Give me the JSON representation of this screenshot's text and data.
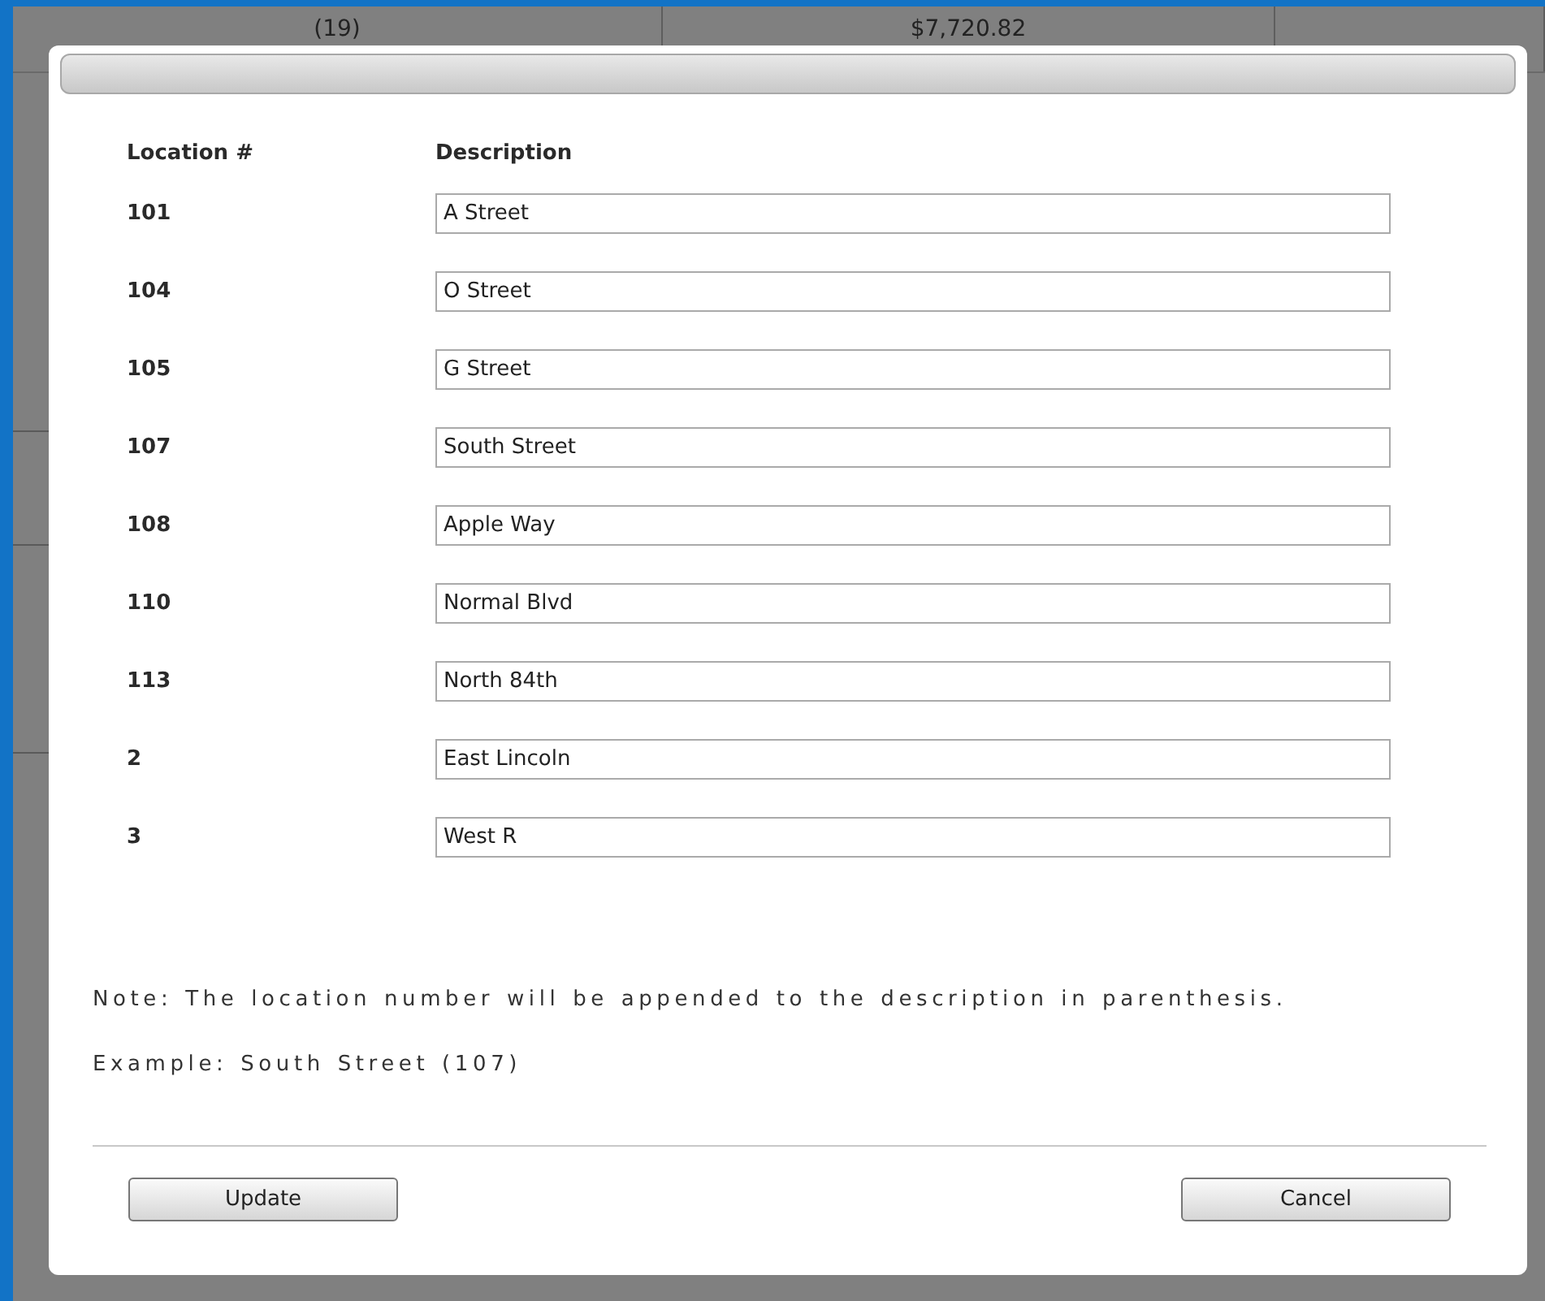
{
  "background_row": {
    "cells": [
      "(19)",
      "$7,720.82"
    ]
  },
  "dialog": {
    "columns": [
      "Location #",
      "Description"
    ],
    "rows": [
      {
        "location": "101",
        "description": "A Street"
      },
      {
        "location": "104",
        "description": "O Street"
      },
      {
        "location": "105",
        "description": "G Street"
      },
      {
        "location": "107",
        "description": "South Street"
      },
      {
        "location": "108",
        "description": "Apple Way"
      },
      {
        "location": "110",
        "description": "Normal Blvd"
      },
      {
        "location": "113",
        "description": "North 84th"
      },
      {
        "location": "2",
        "description": "East Lincoln"
      },
      {
        "location": "3",
        "description": "West R"
      }
    ],
    "note": "Note: The location number will be appended to the description in parenthesis. Example: South Street (107)",
    "buttons": [
      "Update",
      "Cancel"
    ]
  }
}
